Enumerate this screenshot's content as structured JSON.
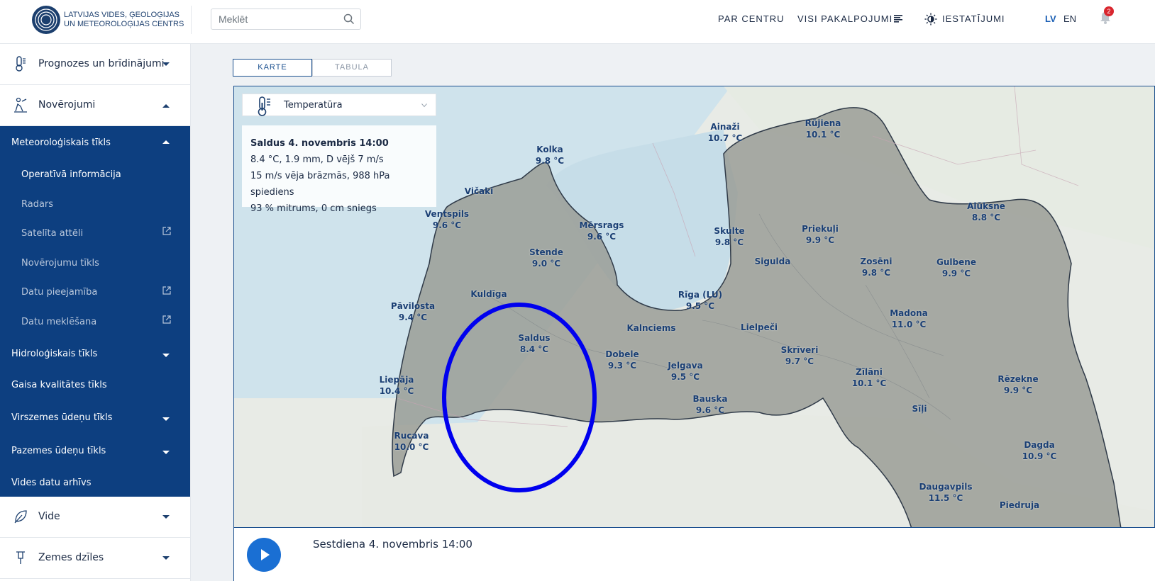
{
  "header": {
    "logo_line1": "LATVIJAS VIDES, ĢEOLOĢIJAS",
    "logo_line2": "UN METEOROLOĢIJAS CENTRS",
    "search_placeholder": "Meklēt",
    "nav_about": "PAR CENTRU",
    "nav_services": "VISI PAKALPOJUMI",
    "nav_settings": "IESTATĪJUMI",
    "lang_lv": "LV",
    "lang_en": "EN",
    "notification_count": "2"
  },
  "sidebar": {
    "forecasts": "Prognozes un brīdinājumi",
    "observations": "Novērojumi",
    "meteo_network": "Meteoroloģiskais tīkls",
    "meteo_items": [
      "Operatīvā informācija",
      "Radars",
      "Satelīta attēli",
      "Novērojumu tīkls",
      "Datu pieejamība",
      "Datu meklēšana"
    ],
    "hydro_network": "Hidroloģiskais tīkls",
    "air_quality": "Gaisa kvalitātes tīkls",
    "surface_water": "Virszemes ūdeņu tīkls",
    "ground_water": "Pazemes ūdeņu tīkls",
    "env_archive": "Vides datu arhīvs",
    "environment": "Vide",
    "subsoil": "Zemes dzīles"
  },
  "tabs": {
    "map": "KARTE",
    "table": "TABULA"
  },
  "parameter": {
    "selected": "Temperatūra"
  },
  "info": {
    "title": "Saldus 4. novembris 14:00",
    "line1": "8.4 °C, 1.9 mm, D vējš 7 m/s",
    "line2": "15 m/s vēja brāzmās, 988 hPa spiediens",
    "line3": "93 % mitrums, 0 cm sniegs"
  },
  "stations": [
    {
      "name": "Ainaži",
      "temp": "10.7 °C"
    },
    {
      "name": "Rūjiena",
      "temp": "10.1 °C"
    },
    {
      "name": "Kolka",
      "temp": "9.8 °C"
    },
    {
      "name": "Vičaki",
      "temp": ""
    },
    {
      "name": "Ventspils",
      "temp": "9.6 °C"
    },
    {
      "name": "Mērsrags",
      "temp": "9.6 °C"
    },
    {
      "name": "Skulte",
      "temp": "9.8 °C"
    },
    {
      "name": "Priekuļi",
      "temp": "9.9 °C"
    },
    {
      "name": "Alūksne",
      "temp": "8.8 °C"
    },
    {
      "name": "Stende",
      "temp": "9.0 °C"
    },
    {
      "name": "Sigulda",
      "temp": ""
    },
    {
      "name": "Zosēni",
      "temp": "9.8 °C"
    },
    {
      "name": "Gulbene",
      "temp": "9.9 °C"
    },
    {
      "name": "Kuldīga",
      "temp": ""
    },
    {
      "name": "Rīga (LU)",
      "temp": "9.5 °C"
    },
    {
      "name": "Pāvilosta",
      "temp": "9.4 °C"
    },
    {
      "name": "Madona",
      "temp": "11.0 °C"
    },
    {
      "name": "Kalnciems",
      "temp": ""
    },
    {
      "name": "Lielpeči",
      "temp": ""
    },
    {
      "name": "Saldus",
      "temp": "8.4 °C"
    },
    {
      "name": "Skrīveri",
      "temp": "9.7 °C"
    },
    {
      "name": "Dobele",
      "temp": "9.3 °C"
    },
    {
      "name": "Jelgava",
      "temp": "9.5 °C"
    },
    {
      "name": "Liepāja",
      "temp": "10.4 °C"
    },
    {
      "name": "Zīlāni",
      "temp": "10.1 °C"
    },
    {
      "name": "Rēzekne",
      "temp": "9.9 °C"
    },
    {
      "name": "Bauska",
      "temp": "9.6 °C"
    },
    {
      "name": "Sīļi",
      "temp": ""
    },
    {
      "name": "Rucava",
      "temp": "10.0 °C"
    },
    {
      "name": "Dagda",
      "temp": "10.9 °C"
    },
    {
      "name": "Daugavpils",
      "temp": "11.5 °C"
    },
    {
      "name": "Piedruja",
      "temp": ""
    }
  ],
  "timeline": {
    "timestamp": "Sestdiena 4. novembris 14:00"
  },
  "colors": {
    "brand_blue": "#0d3f80",
    "highlight_circle": "#0000ee",
    "land": "#9a9d97",
    "sea": "#cfe3ec"
  }
}
